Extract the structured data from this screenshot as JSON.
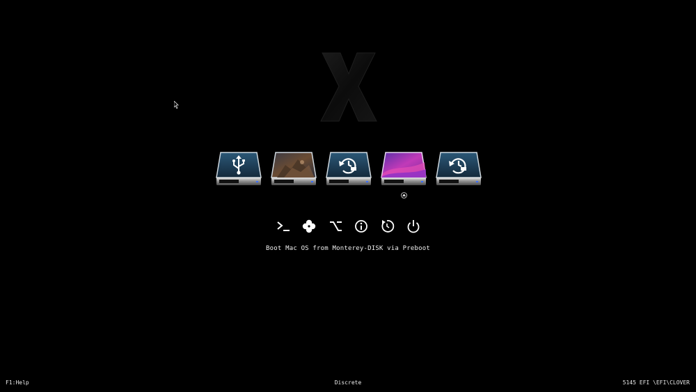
{
  "logo": {
    "icon": "clover-x-logo-icon"
  },
  "cursor": {
    "icon": "mouse-pointer-icon"
  },
  "volumes": [
    {
      "name": "usb-volume",
      "icon": "usb-icon",
      "style": "blue"
    },
    {
      "name": "bigsur-volume",
      "icon": "landscape-wallpaper-icon",
      "style": "photo"
    },
    {
      "name": "recovery-volume",
      "icon": "recovery-clock-icon",
      "style": "blue"
    },
    {
      "name": "monterey-volume",
      "icon": "monterey-wallpaper-icon",
      "style": "purple",
      "selected": true
    },
    {
      "name": "recovery-volume-2",
      "icon": "recovery-clock-icon",
      "style": "blue"
    }
  ],
  "tools": [
    {
      "name": "shell",
      "icon": "shell-prompt-icon"
    },
    {
      "name": "clover-options",
      "icon": "clover-leaf-icon"
    },
    {
      "name": "options",
      "icon": "option-key-icon"
    },
    {
      "name": "about",
      "icon": "info-icon"
    },
    {
      "name": "reset",
      "icon": "reset-icon"
    },
    {
      "name": "shutdown",
      "icon": "power-icon"
    }
  ],
  "message": "Boot Mac OS from Monterey-DISK via Preboot",
  "footer": {
    "help": "F1:Help",
    "gpu_mode": "Discrete",
    "revision": "5145 EFI \\EFI\\CLOVER"
  },
  "colors": {
    "background": "#000000",
    "text": "#eaeaea",
    "drive_blue": "#1c3b55",
    "drive_purple": "#9b2fb4",
    "drive_indicator": "#3a6cff"
  }
}
